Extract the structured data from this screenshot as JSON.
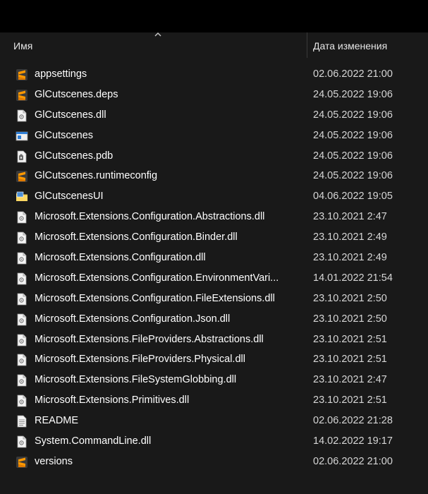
{
  "header": {
    "name_label": "Имя",
    "date_label": "Дата изменения"
  },
  "files": [
    {
      "name": "appsettings",
      "date": "02.06.2022 21:00",
      "icon": "sublime-icon"
    },
    {
      "name": "GlCutscenes.deps",
      "date": "24.05.2022 19:06",
      "icon": "sublime-icon"
    },
    {
      "name": "GlCutscenes.dll",
      "date": "24.05.2022 19:06",
      "icon": "dll-icon"
    },
    {
      "name": "GlCutscenes",
      "date": "24.05.2022 19:06",
      "icon": "exe-icon"
    },
    {
      "name": "GlCutscenes.pdb",
      "date": "24.05.2022 19:06",
      "icon": "pdb-icon"
    },
    {
      "name": "GlCutscenes.runtimeconfig",
      "date": "24.05.2022 19:06",
      "icon": "sublime-icon"
    },
    {
      "name": "GlCutscenesUI",
      "date": "04.06.2022 19:05",
      "icon": "app-folder-icon"
    },
    {
      "name": "Microsoft.Extensions.Configuration.Abstractions.dll",
      "date": "23.10.2021 2:47",
      "icon": "dll-icon"
    },
    {
      "name": "Microsoft.Extensions.Configuration.Binder.dll",
      "date": "23.10.2021 2:49",
      "icon": "dll-icon"
    },
    {
      "name": "Microsoft.Extensions.Configuration.dll",
      "date": "23.10.2021 2:49",
      "icon": "dll-icon"
    },
    {
      "name": "Microsoft.Extensions.Configuration.EnvironmentVari...",
      "date": "14.01.2022 21:54",
      "icon": "dll-icon"
    },
    {
      "name": "Microsoft.Extensions.Configuration.FileExtensions.dll",
      "date": "23.10.2021 2:50",
      "icon": "dll-icon"
    },
    {
      "name": "Microsoft.Extensions.Configuration.Json.dll",
      "date": "23.10.2021 2:50",
      "icon": "dll-icon"
    },
    {
      "name": "Microsoft.Extensions.FileProviders.Abstractions.dll",
      "date": "23.10.2021 2:51",
      "icon": "dll-icon"
    },
    {
      "name": "Microsoft.Extensions.FileProviders.Physical.dll",
      "date": "23.10.2021 2:51",
      "icon": "dll-icon"
    },
    {
      "name": "Microsoft.Extensions.FileSystemGlobbing.dll",
      "date": "23.10.2021 2:47",
      "icon": "dll-icon"
    },
    {
      "name": "Microsoft.Extensions.Primitives.dll",
      "date": "23.10.2021 2:51",
      "icon": "dll-icon"
    },
    {
      "name": "README",
      "date": "02.06.2022 21:28",
      "icon": "text-file-icon"
    },
    {
      "name": "System.CommandLine.dll",
      "date": "14.02.2022 19:17",
      "icon": "dll-icon"
    },
    {
      "name": "versions",
      "date": "02.06.2022 21:00",
      "icon": "sublime-icon"
    }
  ],
  "colors": {
    "background": "#191919",
    "text": "#ffffff",
    "sublime_orange": "#ff9800"
  }
}
